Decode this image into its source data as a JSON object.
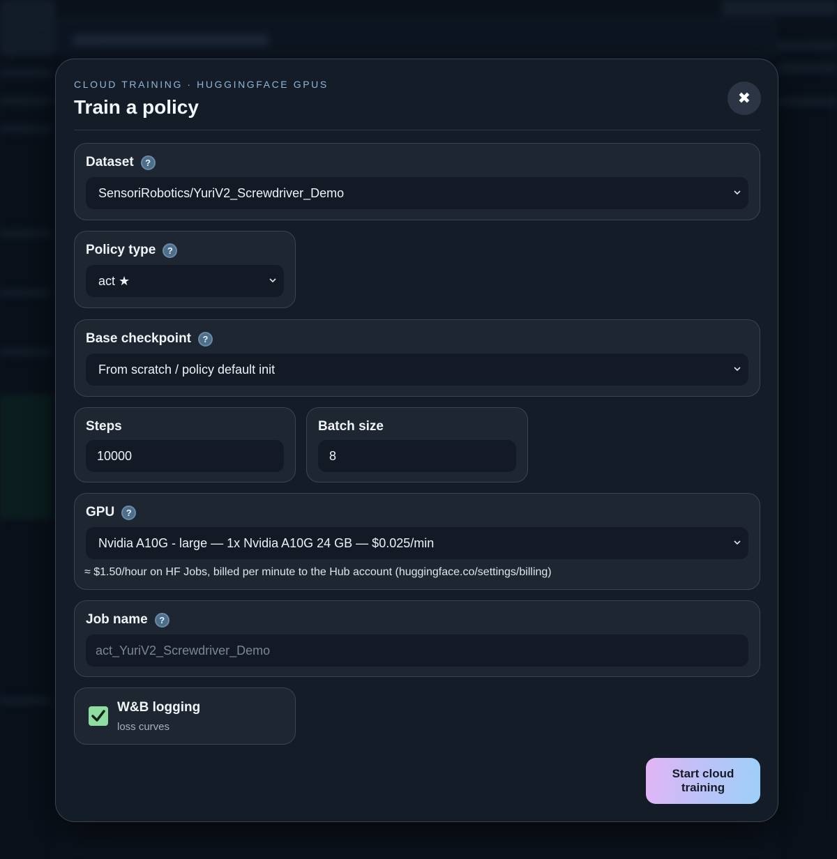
{
  "modal": {
    "eyebrow": "CLOUD TRAINING · HUGGINGFACE GPUS",
    "title": "Train a policy",
    "close_icon": "close-icon"
  },
  "dataset": {
    "label": "Dataset",
    "value": "SensoriRobotics/YuriV2_Screwdriver_Demo"
  },
  "policy_type": {
    "label": "Policy type",
    "value": "act ★"
  },
  "base_checkpoint": {
    "label": "Base checkpoint",
    "value": "From scratch / policy default init"
  },
  "steps": {
    "label": "Steps",
    "value": "10000"
  },
  "batch_size": {
    "label": "Batch size",
    "value": "8"
  },
  "gpu": {
    "label": "GPU",
    "value": "Nvidia A10G - large — 1x Nvidia A10G 24 GB — $0.025/min",
    "hint": "≈ $1.50/hour on HF Jobs, billed per minute to the Hub account (huggingface.co/settings/billing)"
  },
  "job_name": {
    "label": "Job name",
    "placeholder": "act_YuriV2_Screwdriver_Demo"
  },
  "wandb": {
    "label": "W&B logging",
    "sublabel": "loss curves",
    "checked": true
  },
  "actions": {
    "start_label": "Start cloud training"
  },
  "colors": {
    "accent_gradient_start": "#e3b4f5",
    "accent_gradient_end": "#9cd0f8",
    "checkbox_green": "#8fdca0",
    "modal_bg": "#141c28"
  }
}
